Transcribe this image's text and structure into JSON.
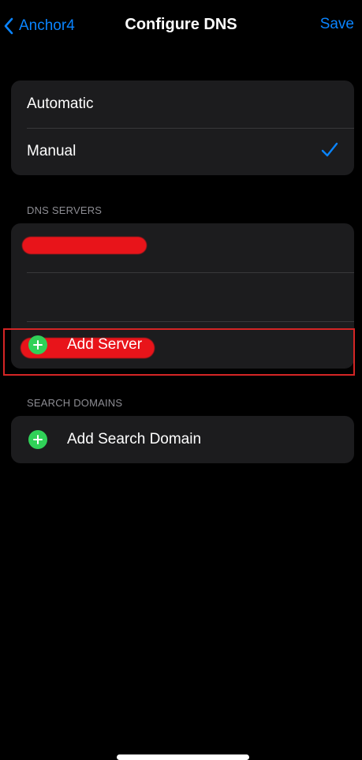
{
  "nav": {
    "back_label": "Anchor4",
    "title": "Configure DNS",
    "save_label": "Save"
  },
  "mode": {
    "options": [
      "Automatic",
      "Manual"
    ],
    "selected": "Manual"
  },
  "dns_servers": {
    "header": "DNS SERVERS",
    "add_label": "Add Server"
  },
  "search_domains": {
    "header": "SEARCH DOMAINS",
    "add_label": "Add Search Domain"
  },
  "icons": {
    "back": "chevron-left-icon",
    "check": "checkmark-icon",
    "add": "plus-circle-icon"
  },
  "colors": {
    "accent": "#0a84ff",
    "add_green": "#30d158",
    "redaction": "#e8141a",
    "highlight": "#d42525"
  }
}
